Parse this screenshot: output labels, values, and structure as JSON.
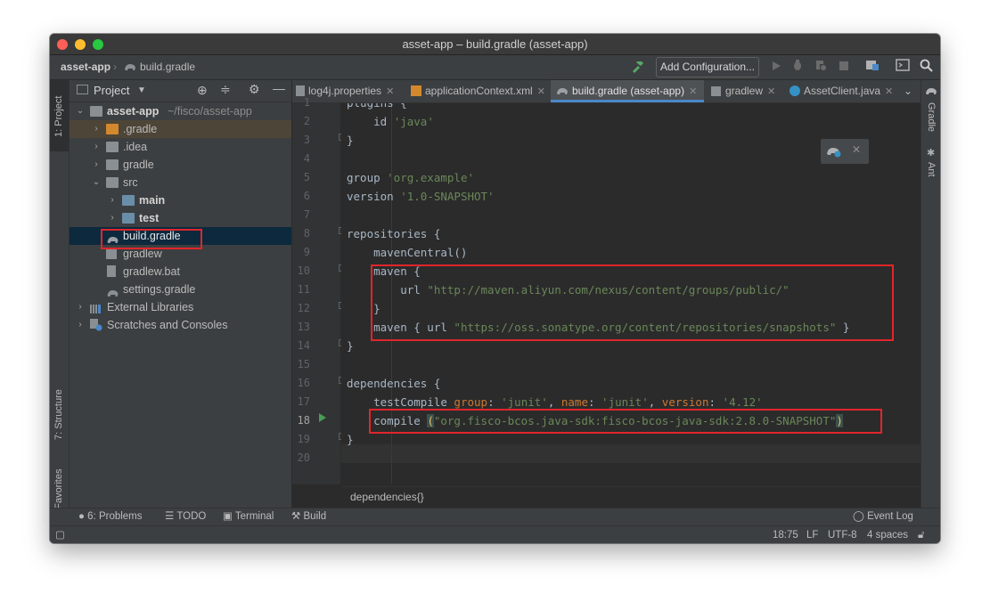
{
  "window": {
    "title": "asset-app – build.gradle (asset-app)"
  },
  "colors": {
    "close": "#ff5f57",
    "minimize": "#febc2e",
    "zoom": "#28c840",
    "accent": "#4a88c7",
    "highlight_box": "#e0262b"
  },
  "navbar": {
    "project": "asset-app",
    "file": "build.gradle",
    "add_configuration": "Add Configuration...",
    "icons": [
      "hammer-icon",
      "run-icon",
      "debug-icon",
      "coverage-icon",
      "stop-icon",
      "project-structure-icon",
      "terminal-icon",
      "search-icon"
    ]
  },
  "left_strip": {
    "project_label": "1: Project",
    "structure_label": "7: Structure",
    "favorites_label": "2: Favorites"
  },
  "right_strip": {
    "gradle_label": "Gradle",
    "ant_label": "Ant"
  },
  "project_panel": {
    "title": "Project",
    "tree": [
      {
        "label": "asset-app",
        "suffix": "~/fisco/asset-app"
      },
      {
        "label": ".gradle"
      },
      {
        "label": ".idea"
      },
      {
        "label": "gradle"
      },
      {
        "label": "src"
      },
      {
        "label": "main"
      },
      {
        "label": "test"
      },
      {
        "label": "build.gradle"
      },
      {
        "label": "gradlew"
      },
      {
        "label": "gradlew.bat"
      },
      {
        "label": "settings.gradle"
      },
      {
        "label": "External Libraries"
      },
      {
        "label": "Scratches and Consoles"
      }
    ]
  },
  "tabs": [
    {
      "label": "log4j.properties"
    },
    {
      "label": "applicationContext.xml"
    },
    {
      "label": "build.gradle (asset-app)"
    },
    {
      "label": "gradlew"
    },
    {
      "label": "AssetClient.java"
    }
  ],
  "editor": {
    "line_numbers": [
      "1",
      "2",
      "3",
      "4",
      "5",
      "6",
      "7",
      "8",
      "9",
      "10",
      "11",
      "12",
      "13",
      "14",
      "15",
      "16",
      "17",
      "18",
      "19",
      "20"
    ],
    "lines": {
      "l1a": "plugins",
      "l1b": " {",
      "l2a": "    id ",
      "l2b": "'java'",
      "l3": "}",
      "l5a": "group ",
      "l5b": "'org.example'",
      "l6a": "version ",
      "l6b": "'1.0-SNAPSHOT'",
      "l8": "repositories {",
      "l9": "    mavenCentral()",
      "l10": "    maven {",
      "l11a": "        url ",
      "l11b": "\"http://maven.aliyun.com/nexus/content/groups/public/\"",
      "l12": "    }",
      "l13a": "    maven { url ",
      "l13b": "\"https://oss.sonatype.org/content/repositories/snapshots\"",
      "l13c": " }",
      "l14": "}",
      "l16": "dependencies {",
      "l17a": "    testCompile ",
      "l17b": "group",
      "l17c": ": ",
      "l17d": "'junit'",
      "l17e": ", ",
      "l17f": "name",
      "l17g": ": ",
      "l17h": "'junit'",
      "l17i": ", ",
      "l17j": "version",
      "l17k": ": ",
      "l17l": "'4.12'",
      "l18a": "    compile ",
      "l18b": "(",
      "l18c": "\"org.fisco-bcos.java-sdk:fisco-bcos-java-sdk:2.8.0-SNAPSHOT\"",
      "l18d": ")",
      "l19": "}"
    },
    "breadcrumb": "dependencies{}"
  },
  "tool_windows": {
    "problems": "6: Problems",
    "todo": "TODO",
    "terminal": "Terminal",
    "build": "Build",
    "event_log": "Event Log"
  },
  "status": {
    "position": "18:75",
    "line_separator": "LF",
    "encoding": "UTF-8",
    "indent": "4 spaces"
  }
}
